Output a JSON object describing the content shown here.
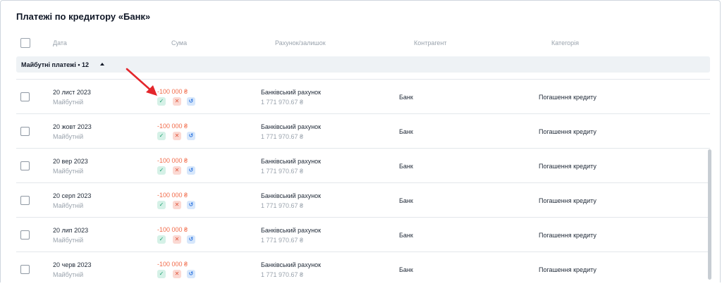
{
  "title": "Платежі по кредитору «Банк»",
  "columns": {
    "date": "Дата",
    "amount": "Сума",
    "account": "Рахунок/залишок",
    "contractor": "Контрагент",
    "category": "Категорія"
  },
  "group": {
    "label": "Майбутні платежі • 12"
  },
  "icons": {
    "confirm": "check-icon",
    "cancel": "close-icon",
    "undo": "undo-icon"
  },
  "colors": {
    "amount": "#f16b4a",
    "confirm": "#20a070",
    "cancel": "#e0573e",
    "undo": "#2d75e0",
    "annotation_arrow": "#e3262b"
  },
  "rows": [
    {
      "date": "20 лист 2023",
      "status": "Майбутній",
      "amount": "-100 000 ₴",
      "account": "Банківський рахунок",
      "balance": "1 771 970.67 ₴",
      "contractor": "Банк",
      "category": "Погашення кредиту"
    },
    {
      "date": "20 жовт 2023",
      "status": "Майбутній",
      "amount": "-100 000 ₴",
      "account": "Банківський рахунок",
      "balance": "1 771 970.67 ₴",
      "contractor": "Банк",
      "category": "Погашення кредиту"
    },
    {
      "date": "20 вер 2023",
      "status": "Майбутній",
      "amount": "-100 000 ₴",
      "account": "Банківський рахунок",
      "balance": "1 771 970.67 ₴",
      "contractor": "Банк",
      "category": "Погашення кредиту"
    },
    {
      "date": "20 серп 2023",
      "status": "Майбутній",
      "amount": "-100 000 ₴",
      "account": "Банківський рахунок",
      "balance": "1 771 970.67 ₴",
      "contractor": "Банк",
      "category": "Погашення кредиту"
    },
    {
      "date": "20 лип 2023",
      "status": "Майбутній",
      "amount": "-100 000 ₴",
      "account": "Банківський рахунок",
      "balance": "1 771 970.67 ₴",
      "contractor": "Банк",
      "category": "Погашення кредиту"
    },
    {
      "date": "20 черв 2023",
      "status": "Майбутній",
      "amount": "-100 000 ₴",
      "account": "Банківський рахунок",
      "balance": "1 771 970.67 ₴",
      "contractor": "Банк",
      "category": "Погашення кредиту"
    }
  ]
}
